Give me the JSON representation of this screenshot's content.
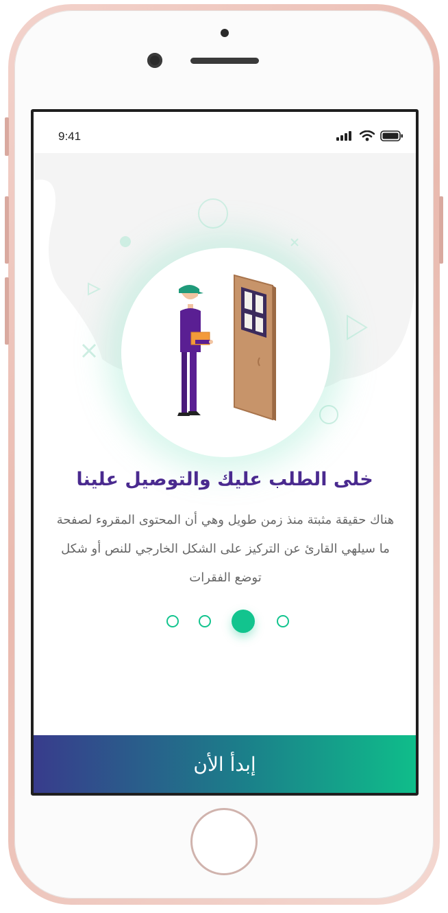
{
  "status_bar": {
    "time": "9:41"
  },
  "onboarding": {
    "title": "خلى الطلب عليك والتوصيل علينا",
    "description": "هناك حقيقة مثبتة منذ زمن طويل وهي أن المحتوى المقروء لصفحة ما سيلهي القارئ عن التركيز على الشكل الخارجي للنص أو شكل توضع الفقرات",
    "pagination": {
      "total": 4,
      "active_index": 2
    }
  },
  "cta": {
    "label": "إبدأ الأن"
  },
  "colors": {
    "accent": "#12c48e",
    "title": "#4a2a8f",
    "gradient_start": "#383c8c",
    "gradient_end": "#0fbd8a"
  }
}
